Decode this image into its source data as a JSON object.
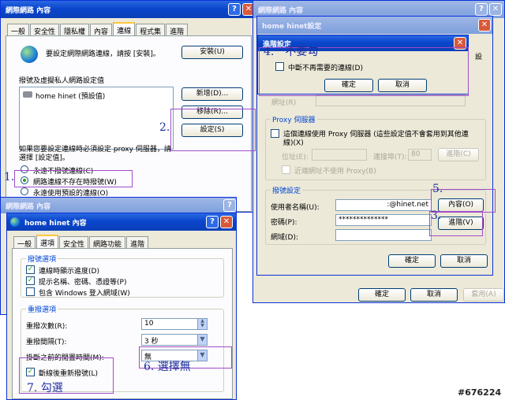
{
  "main_dialog": {
    "title": "網際網路 內容",
    "tabs": [
      "一般",
      "安全性",
      "隱私權",
      "內容",
      "連線",
      "程式集",
      "進階"
    ],
    "active_tab": "連線",
    "setup_text": "要設定網際網路連線，請按 [安裝]。",
    "setup_button": "安裝(U)",
    "dialup_section": "撥號及虛擬私人網路設定值",
    "connection_item": "home hinet (預設值)",
    "add_button": "新增(D)...",
    "remove_button": "移除(R)...",
    "settings_button": "設定(S)",
    "proxy_note_1": "如果您要設定連線時必須設定 proxy 伺服器，請",
    "proxy_note_2": "選擇 [設定值]。",
    "radio_never": "永遠不撥號連線(C)",
    "radio_when_absent": "網路連線不存在時撥號(W)",
    "radio_always": "永遠使用預設的連線(O)"
  },
  "hinet_dialog": {
    "title": "home hinet設定",
    "frag_right": "設",
    "frag_addr": "網址(R)",
    "proxy_group": "Proxy 伺服器",
    "proxy_check_1": "這個連線使用 Proxy 伺服器 (這些設定值不會套用到其他連",
    "proxy_check_2": "線)(X)",
    "address_label": "位址(E):",
    "port_label": "連接埠(T):",
    "port_value": "80",
    "advanced_proxy_button": "進階(C)",
    "bypass_label": "近端網址不使用 Proxy(B)",
    "dialup_group": "撥號設定",
    "username_label": "使用者名稱(U):",
    "username_value": ":@hinet.net",
    "password_label": "密碼(P):",
    "password_value": "**************",
    "domain_label": "網域(D):",
    "properties_button": "內容(O)",
    "advanced_button": "進階(V)",
    "ok_button": "確定",
    "cancel_button": "取消"
  },
  "advanced_dialog": {
    "title": "進階設定",
    "checkbox_label": "中斷不再需要的連線(D)",
    "ok_button": "確定",
    "cancel_button": "取消"
  },
  "bottom_bar": {
    "ok_button": "確定",
    "cancel_button": "取消",
    "apply_button": "套用(A)"
  },
  "bg_titles": {
    "main_right": "網際網路 內容",
    "lower": "網際網路 內容"
  },
  "props_dialog": {
    "title": "home hinet 內容",
    "tabs": [
      "一般",
      "選項",
      "安全性",
      "網路功能",
      "進階"
    ],
    "active_tab": "選項",
    "dial_group": "撥號選項",
    "dial_opt_1": "連線時顯示進度(D)",
    "dial_opt_2": "提示名稱、密碼、憑證等(P)",
    "dial_opt_3": "包含 Windows 登入網域(W)",
    "redial_group": "重撥選項",
    "redial_attempts_label": "重撥次數(R):",
    "redial_attempts_value": "10",
    "redial_interval_label": "重撥間隔(T):",
    "redial_interval_value": "3 秒",
    "idle_label": "掛斷之前的閒置時間(M):",
    "idle_value": "無",
    "reconnect_label": "斷線後重新撥號(L)"
  },
  "annotations": {
    "a1": "1.",
    "a2": "2.",
    "a3": "3.",
    "a4": "4.　不要勾",
    "a5": "5.",
    "a6": "6. 選擇無",
    "a7": "7. 勾選"
  },
  "watermark": "#676224",
  "colors": {
    "title_bar": "#0a46cc",
    "annotation": "#a14dc8",
    "annotation_text": "#1e2f9e"
  }
}
